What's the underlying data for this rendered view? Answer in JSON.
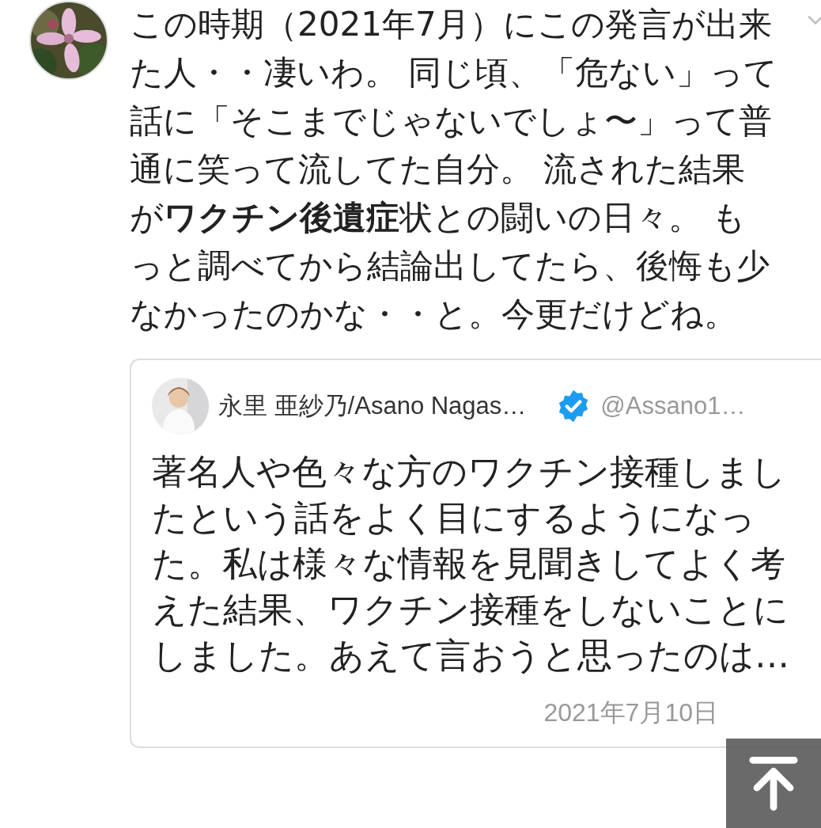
{
  "post": {
    "text": "この時期（2021年7月）にこの発言が出来た人・・凄いわ。 同じ頃、「危ない」って話に「そこまでじゃないでしょ〜」って普通に笑って流してた自分。 流された結果が**ワクチン後遺症**状との闘いの日々。 もっと調べてから結論出してたら、後悔も少なかったのかな・・と。今更だけどね。"
  },
  "quoted_post": {
    "name": "永里 亜紗乃/Asano Nagas…",
    "verified": true,
    "handle": "@Assano1…",
    "text": "著名人や色々な方のワクチン接種しましたという話をよく目にするようになった。私は様々な情報を見聞きしてよく考えた結果、ワクチン接種をしないことにしました。あえて言おうと思ったのは…",
    "date": "2021年7月10日"
  }
}
